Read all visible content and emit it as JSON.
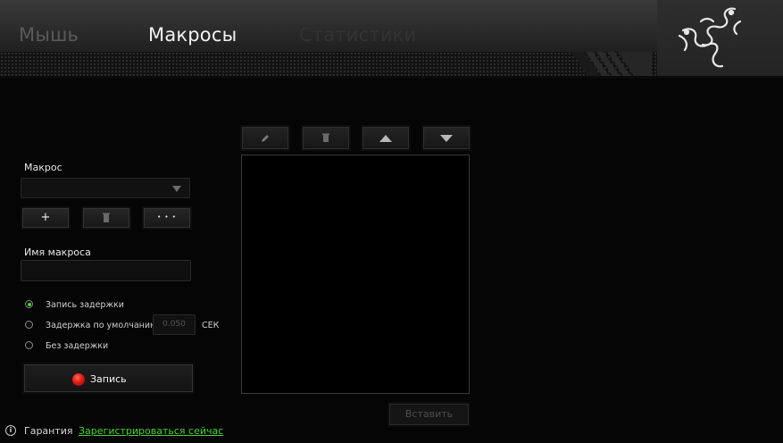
{
  "tabs": {
    "mouse": "Мышь",
    "macros": "Макросы",
    "stats": "Статистики"
  },
  "macro": {
    "label": "Макрос",
    "selected": "",
    "add_symbol": "+",
    "more_symbol": "• • •"
  },
  "macro_name": {
    "label": "Имя макроса",
    "value": ""
  },
  "delay": {
    "record_label": "Запись задержки",
    "default_label": "Задержка по умолчанию",
    "default_value": "0.050",
    "unit": "СЕК",
    "none_label": "Без задержки",
    "selected": "record"
  },
  "record_button": "Запись",
  "insert_button": "Вставить",
  "footer": {
    "info_symbol": "i",
    "warranty": "Гарантия",
    "register_link": "Зарегистрироваться сейчас"
  },
  "colors": {
    "accent": "#44d62c",
    "record": "#e21a10",
    "background": "#050505"
  },
  "icons": {
    "brand": "razer-logo-icon",
    "edit": "pencil-icon",
    "delete": "trash-icon",
    "up": "arrow-up-icon",
    "down": "arrow-down-icon"
  }
}
